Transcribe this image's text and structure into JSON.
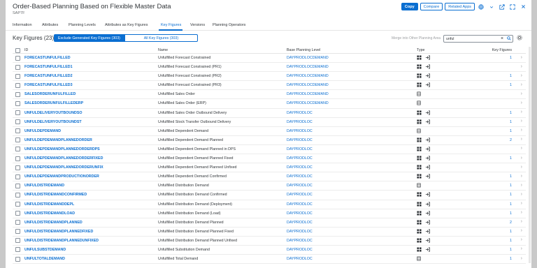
{
  "header": {
    "title": "Order-Based Planning Based on Flexible Master Data",
    "subtitle": "SAP7F",
    "copy_label": "Copy",
    "compare_label": "Compare",
    "related_label": "Related Apps"
  },
  "tabs": [
    {
      "label": "Information"
    },
    {
      "label": "Attributes"
    },
    {
      "label": "Planning Levels"
    },
    {
      "label": "Attributes as Key Figures"
    },
    {
      "label": "Key Figures"
    },
    {
      "label": "Versions"
    },
    {
      "label": "Planning Operators"
    }
  ],
  "toolbar": {
    "count_label": "Key Figures (23)",
    "seg_exclude": "Exclude Generated Key Figures (303)",
    "seg_all": "All Key Figures (303)",
    "merge_label": "Merge into Other Planning Area",
    "search_value": "unful"
  },
  "columns": {
    "id": "ID",
    "name": "Name",
    "base": "Base Planning Level",
    "type": "Type",
    "kf": "Key Figures"
  },
  "rows": [
    {
      "id": "FORECASTUNFULFILLED",
      "name": "Unfulfilled Forecast Constrained",
      "base": "DAYPRODLOCDEMAND",
      "type": "calc-attr",
      "kf": "1"
    },
    {
      "id": "FORECASTUNFULFILLED1",
      "name": "Unfulfilled Forecast Constrained (PR1)",
      "base": "DAYPRODLOCDEMAND",
      "type": "calc-attr",
      "kf": ""
    },
    {
      "id": "FORECASTUNFULFILLED2",
      "name": "Unfulfilled Forecast Constrained (PR2)",
      "base": "DAYPRODLOCDEMAND",
      "type": "calc-attr",
      "kf": "1"
    },
    {
      "id": "FORECASTUNFULFILLED3",
      "name": "Unfulfilled Forecast Constrained (PR3)",
      "base": "DAYPRODLOCDEMAND",
      "type": "calc-attr",
      "kf": "1"
    },
    {
      "id": "SALESORDERUNFULFILLED",
      "name": "Unfulfilled Sales Order",
      "base": "DAYPRODLOCDEMAND",
      "type": "stored",
      "kf": ""
    },
    {
      "id": "SALESORDERUNFULFILLEDERP",
      "name": "Unfulfilled Sales Order (ERP)",
      "base": "DAYPRODLOCDEMAND",
      "type": "stored",
      "kf": ""
    },
    {
      "id": "UNFULDELIVERYOUTBOUNDSO",
      "name": "Unfulfilled Sales Order Outbound Delivery",
      "base": "DAYPRODLOC",
      "type": "calc-attr",
      "kf": "1"
    },
    {
      "id": "UNFULDELIVERYOUTBOUNDST",
      "name": "Unfulfilled Stock Transfer Outbound Delivery",
      "base": "DAYPRODLOC",
      "type": "calc-attr",
      "kf": "1"
    },
    {
      "id": "UNFULDEPDEMAND",
      "name": "Unfulfilled Dependent Demand",
      "base": "DAYPRODLOC",
      "type": "stored",
      "kf": "1"
    },
    {
      "id": "UNFULDEPDEMANDPLANNEDORDER",
      "name": "Unfulfilled Dependent Demand Planned",
      "base": "DAYPRODLOC",
      "type": "calc-attr",
      "kf": "2"
    },
    {
      "id": "UNFULDEPDEMANDPLANNEDORDERDPS",
      "name": "Unfulfilled Dependent Demand Planned in DPS",
      "base": "DAYPRODLOC",
      "type": "calc-attr",
      "kf": ""
    },
    {
      "id": "UNFULDEPDEMANDPLANNEDORDERFIXED",
      "name": "Unfulfilled Dependent Demand Planned Fixed",
      "base": "DAYPRODLOC",
      "type": "calc-attr",
      "kf": "1"
    },
    {
      "id": "UNFULDEPDEMANDPLANNEDORDERUNFIX",
      "name": "Unfulfilled Dependent Demand Planned Unfixed",
      "base": "DAYPRODLOC",
      "type": "calc-attr",
      "kf": ""
    },
    {
      "id": "UNFULDEPDEMANDPRODUCTIONORDER",
      "name": "Unfulfilled Dependent Demand Confirmed",
      "base": "DAYPRODLOC",
      "type": "calc-attr",
      "kf": "1"
    },
    {
      "id": "UNFULDISTRDEMAND",
      "name": "Unfulfilled Distribution Demand",
      "base": "DAYPRODLOC",
      "type": "stored",
      "kf": "1"
    },
    {
      "id": "UNFULDISTRDEMANDCONFIRMED",
      "name": "Unfulfilled Distribution Demand Confirmed",
      "base": "DAYPRODLOC",
      "type": "calc-attr",
      "kf": "1"
    },
    {
      "id": "UNFULDISTRDEMANDDEPL",
      "name": "Unfulfilled Distribution Demand (Deployment)",
      "base": "DAYPRODLOC",
      "type": "calc-attr",
      "kf": "1"
    },
    {
      "id": "UNFULDISTRDEMANDLOAD",
      "name": "Unfulfilled Distribution Demand (Load)",
      "base": "DAYPRODLOC",
      "type": "calc-attr",
      "kf": "1"
    },
    {
      "id": "UNFULDISTRDEMANDPLANNED",
      "name": "Unfulfilled Distribution Demand Planned",
      "base": "DAYPRODLOC",
      "type": "calc-attr",
      "kf": "2"
    },
    {
      "id": "UNFULDISTRDEMANDPLANNEDFIXED",
      "name": "Unfulfilled Distribution Demand Planned Fixed",
      "base": "DAYPRODLOC",
      "type": "calc-attr",
      "kf": "1"
    },
    {
      "id": "UNFULDISTRDEMANDPLANNEDUNFIXED",
      "name": "Unfulfilled Distribution Demand Planned Unfixed",
      "base": "DAYPRODLOC",
      "type": "calc-attr",
      "kf": "1"
    },
    {
      "id": "UNFULSUBSTDEMAND",
      "name": "Unfulfilled Substitution Demand",
      "base": "DAYPRODLOC",
      "type": "calc-attr",
      "kf": "1"
    },
    {
      "id": "UNFULTOTALDEMAND",
      "name": "Unfulfilled Total Demand",
      "base": "DAYPRODLOC",
      "type": "stored",
      "kf": "1"
    }
  ],
  "colors": {
    "accent": "#0a6ed1",
    "text": "#32363a",
    "border": "#e5e5e5"
  }
}
